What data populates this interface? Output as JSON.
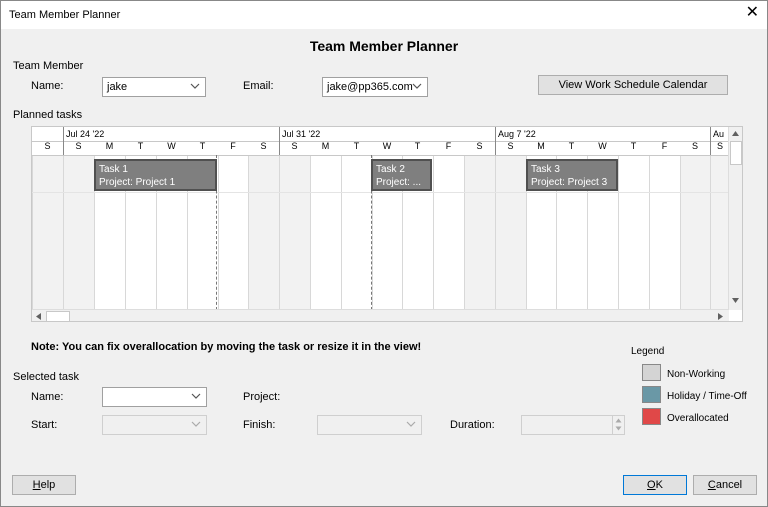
{
  "window": {
    "title": "Team Member Planner",
    "close_glyph": "✕"
  },
  "heading": "Team Member Planner",
  "team_member": {
    "section_label": "Team Member",
    "name_label": "Name:",
    "name_value": "jake",
    "email_label": "Email:",
    "email_value": "jake@pp365.com",
    "calendar_button": "View Work Schedule Calendar"
  },
  "planned_tasks": {
    "section_label": "Planned tasks",
    "weeks": [
      "Jul 24 '22",
      "Jul 31 '22",
      "Aug 7 '22",
      "Au"
    ],
    "days": [
      "S",
      "S",
      "M",
      "T",
      "W",
      "T",
      "F",
      "S",
      "S",
      "M",
      "T",
      "W",
      "T",
      "F",
      "S",
      "S",
      "M",
      "T",
      "W",
      "T",
      "F",
      "S",
      "S"
    ],
    "tasks": [
      {
        "name": "Task 1",
        "project": "Project: Project 1"
      },
      {
        "name": "Task 2",
        "project": "Project: ..."
      },
      {
        "name": "Task 3",
        "project": "Project: Project 3"
      }
    ]
  },
  "note": "Note: You can fix overallocation by moving the task or resize it in the view!",
  "legend": {
    "title": "Legend",
    "items": [
      {
        "label": "Non-Working",
        "color": "#d4d4d4"
      },
      {
        "label": "Holiday / Time-Off",
        "color": "#6a98a6"
      },
      {
        "label": "Overallocated",
        "color": "#e04848"
      }
    ]
  },
  "selected_task": {
    "section_label": "Selected task",
    "name_label": "Name:",
    "name_value": "",
    "project_label": "Project:",
    "start_label": "Start:",
    "start_value": "",
    "finish_label": "Finish:",
    "finish_value": "",
    "duration_label": "Duration:",
    "duration_value": ""
  },
  "buttons": {
    "help_prefix": "",
    "help_u": "H",
    "help_rest": "elp",
    "ok_u": "O",
    "ok_rest": "K",
    "cancel_u": "C",
    "cancel_rest": "ancel"
  }
}
